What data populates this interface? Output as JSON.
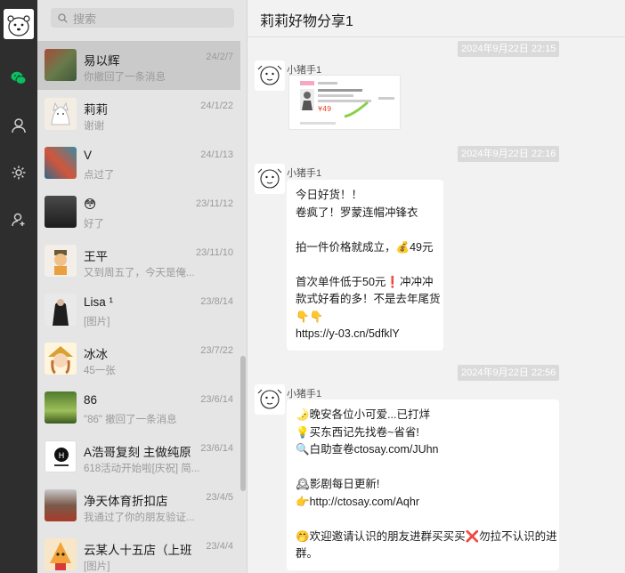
{
  "sidebar": {
    "icons": [
      "user-avatar",
      "chat-icon",
      "contacts-icon",
      "settings-icon",
      "add-friend-icon"
    ]
  },
  "search": {
    "placeholder": "搜索"
  },
  "chats": [
    {
      "name": "易以辉",
      "date": "24/2/7",
      "preview": "你撤回了一条消息"
    },
    {
      "name": "莉莉",
      "date": "24/1/22",
      "preview": "谢谢"
    },
    {
      "name": "V",
      "date": "24/1/13",
      "preview": "点过了"
    },
    {
      "name": "😳",
      "date": "23/11/12",
      "preview": "好了"
    },
    {
      "name": "王平",
      "date": "23/11/10",
      "preview": "又到周五了，今天是俺..."
    },
    {
      "name": "Lisa ¹",
      "date": "23/8/14",
      "preview": "[图片]"
    },
    {
      "name": "冰冰",
      "date": "23/7/22",
      "preview": "45一张"
    },
    {
      "name": "86",
      "date": "23/6/14",
      "preview": "\"86\" 撤回了一条消息"
    },
    {
      "name": "A浩哥复刻 主做纯原...",
      "date": "23/6/14",
      "preview": "618活动开始啦[庆祝] 简..."
    },
    {
      "name": "净天体育折扣店",
      "date": "23/4/5",
      "preview": "我通过了你的朋友验证..."
    },
    {
      "name": "云某人十五店（上班...",
      "date": "23/4/4",
      "preview": "[图片]"
    }
  ],
  "chat": {
    "title": "莉莉好物分享1",
    "timestamps": [
      "2024年9月22日 22:15",
      "2024年9月22日 22:16",
      "2024年9月22日 22:56"
    ],
    "sender": "小猪手1",
    "msg1": [
      "今日好货！！",
      "卷疯了！罗蒙连帽冲锋衣",
      "",
      "拍一件价格就成立，💰49元",
      "",
      "首次单件低于50元❗冲冲冲",
      "款式好看的多！不是去年尾货",
      "👇👇",
      "https://y-03.cn/5dfklY"
    ],
    "msg2": [
      "🌛晚安各位小可爱...已打烊",
      "💡买东西记先找卷~省省!",
      "🔍白助查卷ctosay.com/JUhn",
      "",
      "🕰影剧每日更新!",
      "👉http://ctosay.com/Aqhr",
      "",
      "🤭欢迎邀请认识的朋友进群买买买❌勿拉不认识的进",
      "群。"
    ]
  },
  "colors": {
    "rail": "#2e2e2e",
    "accent": "#07c160",
    "list": "#e6e5e5",
    "active": "#cacaca",
    "main": "#f2f2f2"
  }
}
